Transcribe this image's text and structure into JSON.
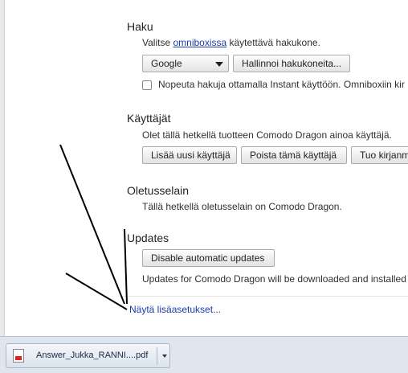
{
  "haku": {
    "title": "Haku",
    "desc_prefix": "Valitse ",
    "desc_link": "omniboxissa",
    "desc_suffix": " käytettävä hakukone.",
    "engine_select": "Google",
    "manage_button": "Hallinnoi hakukoneita...",
    "instant_checkbox_label": "Nopeuta hakuja ottamalla Instant käyttöön. Omniboxiin kir"
  },
  "users": {
    "title": "Käyttäjät",
    "desc": "Olet tällä hetkellä tuotteen Comodo Dragon ainoa käyttäjä.",
    "add_button": "Lisää uusi käyttäjä",
    "delete_button": "Poista tämä käyttäjä",
    "import_button": "Tuo kirjanm"
  },
  "default_browser": {
    "title": "Oletusselain",
    "desc": "Tällä hetkellä oletusselain on Comodo Dragon."
  },
  "updates": {
    "title": "Updates",
    "disable_button": "Disable automatic updates",
    "desc": "Updates for Comodo Dragon will be downloaded and installed"
  },
  "advanced_link": "Näytä lisäasetukset...",
  "download_bar": {
    "file_name": "Answer_Jukka_RANNI....pdf"
  },
  "colors": {
    "link": "#1a3caa",
    "download_bar_bg": "#dfe6ee"
  },
  "icons": [
    "pdf-file-icon",
    "chevron-down-icon"
  ]
}
